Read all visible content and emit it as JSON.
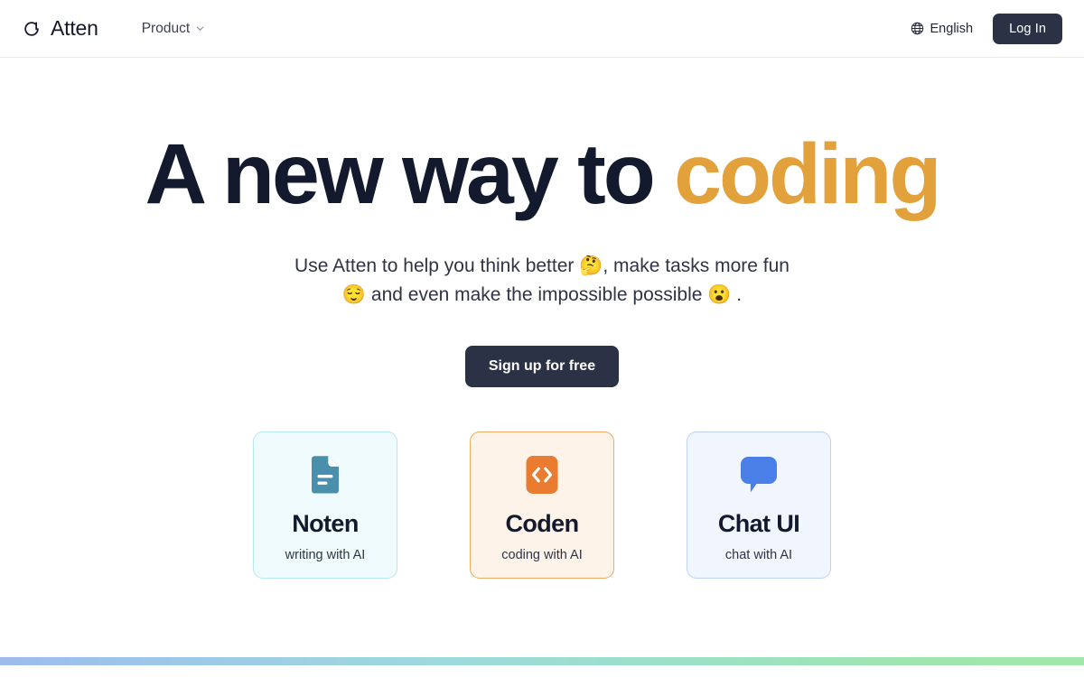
{
  "header": {
    "brand_name": "Atten",
    "brand_icon": "atten-logo-mark",
    "nav": [
      {
        "label": "Product",
        "icon": "chevron-down-icon"
      }
    ],
    "language": {
      "label": "English",
      "icon": "globe-icon"
    },
    "login_label": "Log In"
  },
  "hero": {
    "headline_part1": "A new way to ",
    "headline_accent": "coding",
    "subtitle_line1": "Use Atten to help you think better 🤔, make tasks more fun",
    "subtitle_line2": "😌 and even make the impossible possible 😮 .",
    "cta_label": "Sign up for free"
  },
  "cards": [
    {
      "title": "Noten",
      "subtitle": "writing with AI",
      "icon": "document-icon",
      "icon_color": "#4a90ac",
      "bg": "#effbfd",
      "border": "#b6e6f0"
    },
    {
      "title": "Coden",
      "subtitle": "coding with AI",
      "icon": "code-brackets-icon",
      "icon_color": "#ea7c32",
      "bg": "#fdf3e9",
      "border": "#eeab63"
    },
    {
      "title": "Chat UI",
      "subtitle": "chat with AI",
      "icon": "speech-bubble-icon",
      "icon_color": "#4a7fe8",
      "bg": "#f0f5fe",
      "border": "#bed3f5"
    }
  ],
  "theme": {
    "text_dark": "#141a2e",
    "accent_orange": "#e3a13c",
    "button_dark": "#2b3245",
    "gradient_start": "#9cbcec",
    "gradient_end": "#9ee6ae"
  }
}
